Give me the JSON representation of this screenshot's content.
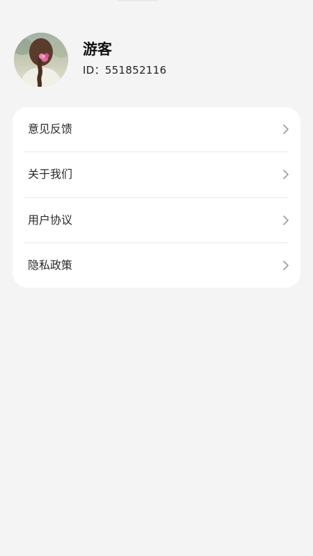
{
  "profile": {
    "name": "游客",
    "id_label": "ID：",
    "id_value": "551852116"
  },
  "menu": {
    "items": [
      {
        "label": "意见反馈",
        "icon": "chevron-right-icon"
      },
      {
        "label": "关于我们",
        "icon": "chevron-right-icon"
      },
      {
        "label": "用户协议",
        "icon": "chevron-right-icon"
      },
      {
        "label": "隐私政策",
        "icon": "chevron-right-icon"
      }
    ]
  },
  "colors": {
    "page_background": "#f4f4f4",
    "card_background": "#ffffff",
    "divider": "#e6e6e6",
    "chevron": "#9a9a9a"
  }
}
